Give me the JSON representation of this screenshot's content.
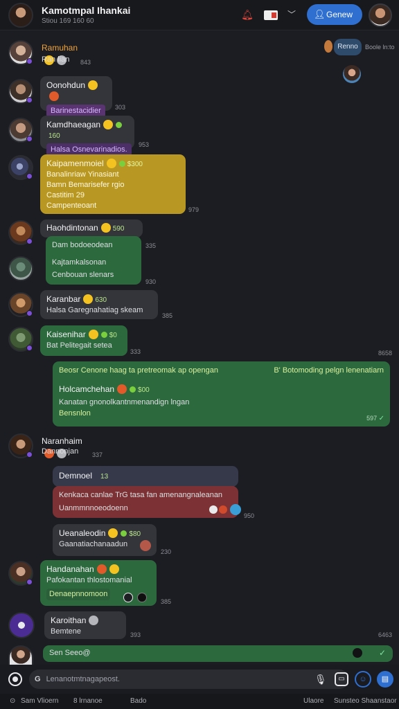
{
  "header": {
    "title": "Kamotmpal Ihankai",
    "subtitle": "Stiou 169 160 60",
    "primary_button": "Genew"
  },
  "presence": {
    "name": "Renno",
    "time": "Boole ln:to"
  },
  "messages": [
    {
      "name": "Ramuhan",
      "text": "Ran lian",
      "time": "843"
    },
    {
      "name": "Oonohdun",
      "text": "Barinestacidier",
      "time": "303"
    },
    {
      "name": "Kamdhaeagan",
      "tag": "160",
      "text": "Halsa Osnevarinadios.",
      "time": "953"
    },
    {
      "name": "Kaipamenmoiel",
      "tag": "$300",
      "lines": [
        "Banalinriaw Yinasiant",
        "Bamn Bemarisefer rgio",
        "Castitim 29",
        "Campenteoant"
      ],
      "time": "979"
    },
    {
      "name": "Haohdintonan",
      "tag": "590",
      "text1": "Dam bodoeodean",
      "time1": "335",
      "text2": "Kajtamkalsonan",
      "text3": "Cenbouan slenars",
      "time2": "930"
    },
    {
      "name": "Karanbar",
      "tag": "630",
      "text": "Halsa Garegnahatiag skeam",
      "time": "385"
    },
    {
      "name": "Kaisenihar",
      "tag": "$0",
      "text": "Bat Pelitegait setea",
      "time": "333",
      "time_right": "8658"
    },
    {
      "header_left": "Beosr Cenone haag ta pretreomak ap opengan",
      "header_right": "B' Botomoding pelgn lenenatiarn",
      "name": "Holcamchehan",
      "tag": "$00",
      "text": "Kanatan gnonolkantnmenandign lngan",
      "footer": "Bensnlon",
      "time": "597"
    },
    {
      "name": "Naranhaim",
      "text": "Dannonjan",
      "time": "337"
    },
    {
      "title": "Demnoel",
      "tag": "13",
      "text": "Kenkaca canlae TrG tasa fan amenangnaleanan",
      "text2": "Uanmmnnoeodoenn",
      "time": "950"
    },
    {
      "name": "Ueanaleodin",
      "tag": "$80",
      "text": "Gaanatiachanaadun",
      "time": "230"
    },
    {
      "name": "Handanahan",
      "text": "Pafokantan thlostomanial",
      "text2": "Denaepnnomoon",
      "time": "385"
    },
    {
      "name": "Karoithan",
      "text": "Bemtene",
      "time": "393",
      "time_right": "6463"
    },
    {
      "text": "Sen Seeo@"
    }
  ],
  "composer": {
    "placeholder": "Lenanotmtnagapeost."
  },
  "statusbar": {
    "left": "Sam Vlioern",
    "mid1": "8 lrnanoe",
    "mid2": "Bado",
    "right1": "Ulaore",
    "right2": "Sunsteo Shaanstaor"
  },
  "colors": {
    "background": "#1c1d22",
    "accent_blue": "#2f6fd0",
    "bubble_green": "#2c6a3e",
    "bubble_gold": "#b89822",
    "bubble_red": "#7c3234"
  }
}
